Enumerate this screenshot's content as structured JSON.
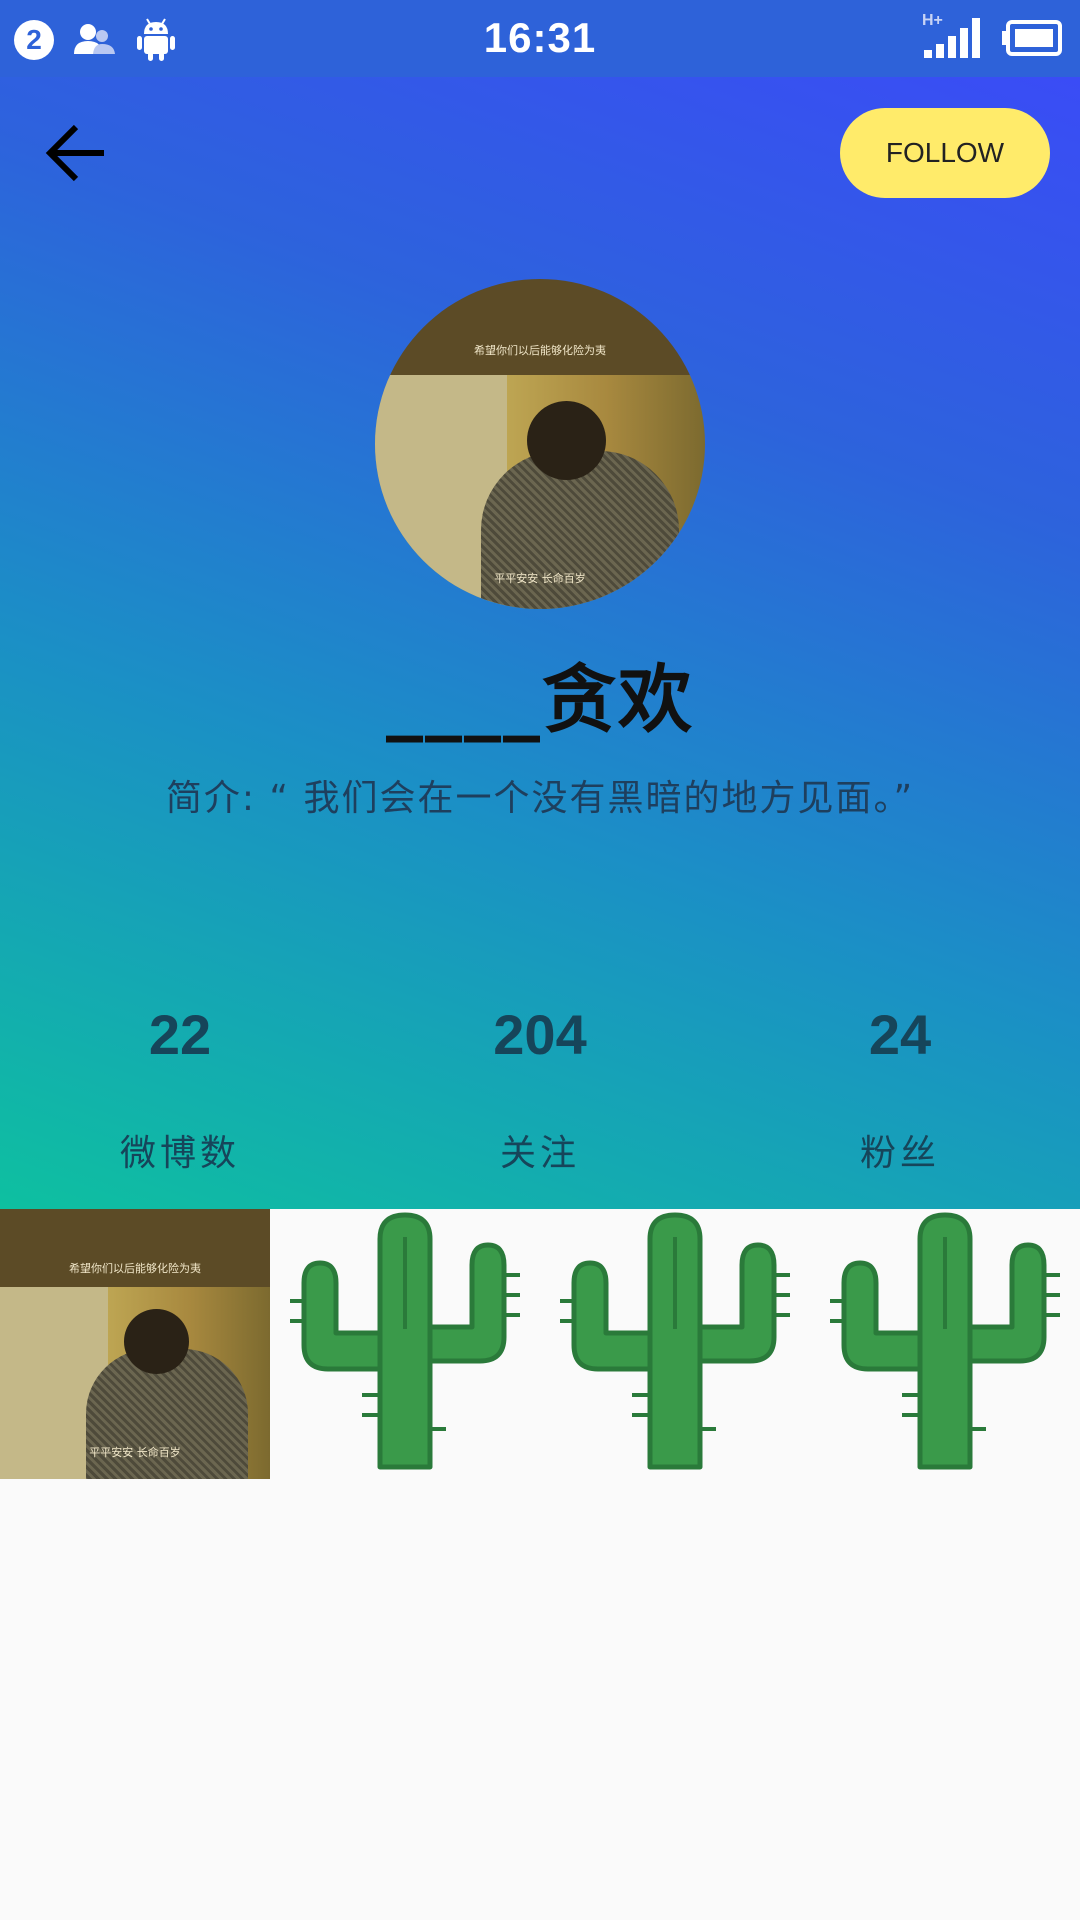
{
  "status_bar": {
    "notification_count": "2",
    "time": "16:31",
    "network_label": "H+"
  },
  "header": {
    "follow_label": "FOLLOW",
    "username": "____贪欢",
    "bio": "简介: “ 我们会在一个没有黑暗的地方见面。”"
  },
  "avatar": {
    "caption_top": "希望你们以后能够化险为夷",
    "caption_bottom": "平平安安 长命百岁"
  },
  "stats": [
    {
      "value": "22",
      "label": "微博数"
    },
    {
      "value": "204",
      "label": "关注"
    },
    {
      "value": "24",
      "label": "粉丝"
    }
  ],
  "grid": {
    "photo_caption_top": "希望你们以后能够化险为夷",
    "photo_caption_bottom": "平平安安 长命百岁",
    "cactus_icon": "cactus-icon"
  },
  "colors": {
    "status_bar": "#2e62d9",
    "gradient_top_right": "#3a4cf6",
    "gradient_bottom_left": "#0ec0a0",
    "follow_button": "#ffeb6a",
    "cactus": "#3a9a4a"
  }
}
